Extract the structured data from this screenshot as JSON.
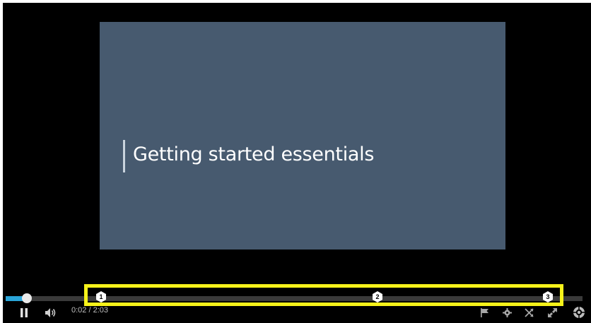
{
  "slide": {
    "title": "Getting started essentials",
    "background_color": "#475a6f"
  },
  "playback": {
    "state": "playing",
    "progress_fraction": 0.02,
    "time_label": "0:02 / 2:03"
  },
  "chapters": [
    {
      "label": "1",
      "position_fraction": 0.165
    },
    {
      "label": "2",
      "position_fraction": 0.645
    },
    {
      "label": "3",
      "position_fraction": 0.94
    }
  ],
  "annotation": {
    "highlight_color": "#f6f21a"
  },
  "colors": {
    "progress_fill": "#2aa5d8",
    "player_background": "#000000"
  },
  "icons": {
    "pause": "pause-icon",
    "volume": "volume-icon",
    "flag": "flag-icon",
    "settings": "gear-icon",
    "shuffle": "crossed-arrows-icon",
    "fullscreen": "fullscreen-icon",
    "menu": "wheel-menu-icon"
  }
}
